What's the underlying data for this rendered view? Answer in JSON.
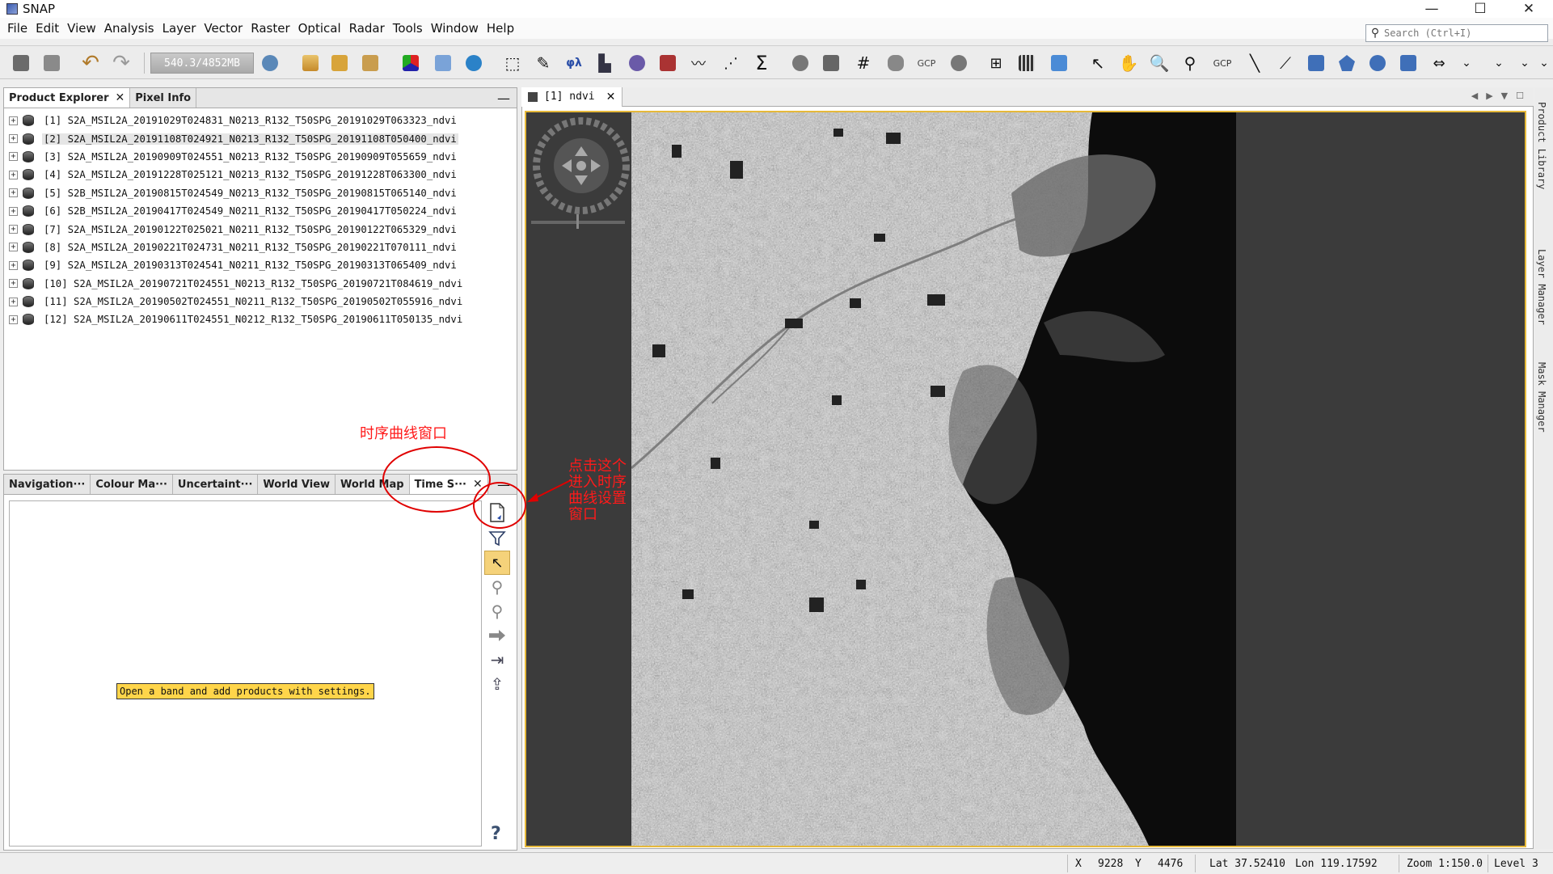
{
  "window": {
    "title": "SNAP",
    "minimize": "—",
    "maximize": "☐",
    "close": "✕"
  },
  "menu": [
    "File",
    "Edit",
    "View",
    "Analysis",
    "Layer",
    "Vector",
    "Raster",
    "Optical",
    "Radar",
    "Tools",
    "Window",
    "Help"
  ],
  "search": {
    "placeholder": "Search (Ctrl+I)",
    "icon": "search-icon"
  },
  "toolbar": {
    "memory": "540.3/4852MB"
  },
  "explorer": {
    "tabs": [
      {
        "label": "Product Explorer",
        "close": "✕"
      },
      {
        "label": "Pixel Info"
      }
    ],
    "minimize": "—",
    "products": [
      {
        "label": "[1]  S2A_MSIL2A_20191029T024831_N0213_R132_T50SPG_20191029T063323_ndvi"
      },
      {
        "label": "[2]  S2A_MSIL2A_20191108T024921_N0213_R132_T50SPG_20191108T050400_ndvi"
      },
      {
        "label": "[3]  S2A_MSIL2A_20190909T024551_N0213_R132_T50SPG_20190909T055659_ndvi"
      },
      {
        "label": "[4]  S2A_MSIL2A_20191228T025121_N0213_R132_T50SPG_20191228T063300_ndvi"
      },
      {
        "label": "[5]  S2B_MSIL2A_20190815T024549_N0213_R132_T50SPG_20190815T065140_ndvi"
      },
      {
        "label": "[6]  S2B_MSIL2A_20190417T024549_N0211_R132_T50SPG_20190417T050224_ndvi"
      },
      {
        "label": "[7]  S2A_MSIL2A_20190122T025021_N0211_R132_T50SPG_20190122T065329_ndvi"
      },
      {
        "label": "[8]  S2A_MSIL2A_20190221T024731_N0211_R132_T50SPG_20190221T070111_ndvi"
      },
      {
        "label": "[9]  S2A_MSIL2A_20190313T024541_N0211_R132_T50SPG_20190313T065409_ndvi"
      },
      {
        "label": "[10]  S2A_MSIL2A_20190721T024551_N0213_R132_T50SPG_20190721T084619_ndvi"
      },
      {
        "label": "[11]  S2A_MSIL2A_20190502T024551_N0211_R132_T50SPG_20190502T055916_ndvi"
      },
      {
        "label": "[12]  S2A_MSIL2A_20190611T024551_N0212_R132_T50SPG_20190611T050135_ndvi"
      }
    ],
    "selected_index": 1
  },
  "tool_panel": {
    "tabs": [
      "Navigation···",
      "Colour Ma···",
      "Uncertaint···",
      "World View",
      "World Map",
      "Time S···"
    ],
    "active_tab_close": "✕",
    "minimize": "—",
    "hint": "Open a band and add products with settings.",
    "help": "?"
  },
  "image_view": {
    "tab_label": "[1] ndvi",
    "tab_close": "✕",
    "controls": [
      "◀",
      "▶",
      "▼",
      "☐"
    ]
  },
  "right_dock": [
    "Product Library",
    "Layer Manager",
    "Mask Manager"
  ],
  "status": {
    "x_label": "X",
    "x_value": "9228",
    "y_label": "Y",
    "y_value": "4476",
    "lat": "Lat 37.52410",
    "lon": "Lon 119.17592",
    "zoom": "Zoom 1:150.0",
    "level": "Level 3"
  },
  "annotations": {
    "window_label": "时序曲线窗口",
    "click_hint": [
      "点击这个",
      "进入时序",
      "曲线设置",
      "窗口"
    ]
  },
  "colors": {
    "accent_border": "#e6b93a",
    "annotation_red": "#e00000",
    "hint_bg": "#ffd54a"
  }
}
